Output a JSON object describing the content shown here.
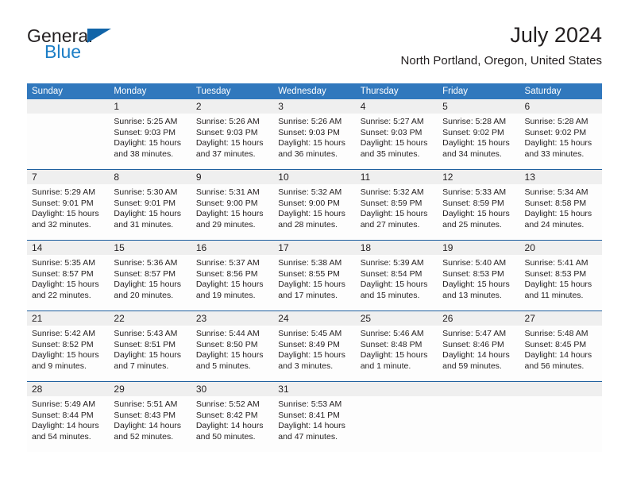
{
  "brand": {
    "name_top": "General",
    "name_bottom": "Blue",
    "accent_color": "#1164a8",
    "blue_text_color": "#1c7ec6"
  },
  "header": {
    "month_title": "July 2024",
    "location": "North Portland, Oregon, United States"
  },
  "calendar": {
    "header_bg_color": "#3178bd",
    "number_band_color": "#efefef",
    "separator_color": "#1d5e9e",
    "day_names": [
      "Sunday",
      "Monday",
      "Tuesday",
      "Wednesday",
      "Thursday",
      "Friday",
      "Saturday"
    ],
    "weeks": [
      [
        {
          "day": "",
          "sunrise": "",
          "sunset": "",
          "daylight": ""
        },
        {
          "day": "1",
          "sunrise": "Sunrise: 5:25 AM",
          "sunset": "Sunset: 9:03 PM",
          "daylight": "Daylight: 15 hours and 38 minutes."
        },
        {
          "day": "2",
          "sunrise": "Sunrise: 5:26 AM",
          "sunset": "Sunset: 9:03 PM",
          "daylight": "Daylight: 15 hours and 37 minutes."
        },
        {
          "day": "3",
          "sunrise": "Sunrise: 5:26 AM",
          "sunset": "Sunset: 9:03 PM",
          "daylight": "Daylight: 15 hours and 36 minutes."
        },
        {
          "day": "4",
          "sunrise": "Sunrise: 5:27 AM",
          "sunset": "Sunset: 9:03 PM",
          "daylight": "Daylight: 15 hours and 35 minutes."
        },
        {
          "day": "5",
          "sunrise": "Sunrise: 5:28 AM",
          "sunset": "Sunset: 9:02 PM",
          "daylight": "Daylight: 15 hours and 34 minutes."
        },
        {
          "day": "6",
          "sunrise": "Sunrise: 5:28 AM",
          "sunset": "Sunset: 9:02 PM",
          "daylight": "Daylight: 15 hours and 33 minutes."
        }
      ],
      [
        {
          "day": "7",
          "sunrise": "Sunrise: 5:29 AM",
          "sunset": "Sunset: 9:01 PM",
          "daylight": "Daylight: 15 hours and 32 minutes."
        },
        {
          "day": "8",
          "sunrise": "Sunrise: 5:30 AM",
          "sunset": "Sunset: 9:01 PM",
          "daylight": "Daylight: 15 hours and 31 minutes."
        },
        {
          "day": "9",
          "sunrise": "Sunrise: 5:31 AM",
          "sunset": "Sunset: 9:00 PM",
          "daylight": "Daylight: 15 hours and 29 minutes."
        },
        {
          "day": "10",
          "sunrise": "Sunrise: 5:32 AM",
          "sunset": "Sunset: 9:00 PM",
          "daylight": "Daylight: 15 hours and 28 minutes."
        },
        {
          "day": "11",
          "sunrise": "Sunrise: 5:32 AM",
          "sunset": "Sunset: 8:59 PM",
          "daylight": "Daylight: 15 hours and 27 minutes."
        },
        {
          "day": "12",
          "sunrise": "Sunrise: 5:33 AM",
          "sunset": "Sunset: 8:59 PM",
          "daylight": "Daylight: 15 hours and 25 minutes."
        },
        {
          "day": "13",
          "sunrise": "Sunrise: 5:34 AM",
          "sunset": "Sunset: 8:58 PM",
          "daylight": "Daylight: 15 hours and 24 minutes."
        }
      ],
      [
        {
          "day": "14",
          "sunrise": "Sunrise: 5:35 AM",
          "sunset": "Sunset: 8:57 PM",
          "daylight": "Daylight: 15 hours and 22 minutes."
        },
        {
          "day": "15",
          "sunrise": "Sunrise: 5:36 AM",
          "sunset": "Sunset: 8:57 PM",
          "daylight": "Daylight: 15 hours and 20 minutes."
        },
        {
          "day": "16",
          "sunrise": "Sunrise: 5:37 AM",
          "sunset": "Sunset: 8:56 PM",
          "daylight": "Daylight: 15 hours and 19 minutes."
        },
        {
          "day": "17",
          "sunrise": "Sunrise: 5:38 AM",
          "sunset": "Sunset: 8:55 PM",
          "daylight": "Daylight: 15 hours and 17 minutes."
        },
        {
          "day": "18",
          "sunrise": "Sunrise: 5:39 AM",
          "sunset": "Sunset: 8:54 PM",
          "daylight": "Daylight: 15 hours and 15 minutes."
        },
        {
          "day": "19",
          "sunrise": "Sunrise: 5:40 AM",
          "sunset": "Sunset: 8:53 PM",
          "daylight": "Daylight: 15 hours and 13 minutes."
        },
        {
          "day": "20",
          "sunrise": "Sunrise: 5:41 AM",
          "sunset": "Sunset: 8:53 PM",
          "daylight": "Daylight: 15 hours and 11 minutes."
        }
      ],
      [
        {
          "day": "21",
          "sunrise": "Sunrise: 5:42 AM",
          "sunset": "Sunset: 8:52 PM",
          "daylight": "Daylight: 15 hours and 9 minutes."
        },
        {
          "day": "22",
          "sunrise": "Sunrise: 5:43 AM",
          "sunset": "Sunset: 8:51 PM",
          "daylight": "Daylight: 15 hours and 7 minutes."
        },
        {
          "day": "23",
          "sunrise": "Sunrise: 5:44 AM",
          "sunset": "Sunset: 8:50 PM",
          "daylight": "Daylight: 15 hours and 5 minutes."
        },
        {
          "day": "24",
          "sunrise": "Sunrise: 5:45 AM",
          "sunset": "Sunset: 8:49 PM",
          "daylight": "Daylight: 15 hours and 3 minutes."
        },
        {
          "day": "25",
          "sunrise": "Sunrise: 5:46 AM",
          "sunset": "Sunset: 8:48 PM",
          "daylight": "Daylight: 15 hours and 1 minute."
        },
        {
          "day": "26",
          "sunrise": "Sunrise: 5:47 AM",
          "sunset": "Sunset: 8:46 PM",
          "daylight": "Daylight: 14 hours and 59 minutes."
        },
        {
          "day": "27",
          "sunrise": "Sunrise: 5:48 AM",
          "sunset": "Sunset: 8:45 PM",
          "daylight": "Daylight: 14 hours and 56 minutes."
        }
      ],
      [
        {
          "day": "28",
          "sunrise": "Sunrise: 5:49 AM",
          "sunset": "Sunset: 8:44 PM",
          "daylight": "Daylight: 14 hours and 54 minutes."
        },
        {
          "day": "29",
          "sunrise": "Sunrise: 5:51 AM",
          "sunset": "Sunset: 8:43 PM",
          "daylight": "Daylight: 14 hours and 52 minutes."
        },
        {
          "day": "30",
          "sunrise": "Sunrise: 5:52 AM",
          "sunset": "Sunset: 8:42 PM",
          "daylight": "Daylight: 14 hours and 50 minutes."
        },
        {
          "day": "31",
          "sunrise": "Sunrise: 5:53 AM",
          "sunset": "Sunset: 8:41 PM",
          "daylight": "Daylight: 14 hours and 47 minutes."
        },
        {
          "day": "",
          "sunrise": "",
          "sunset": "",
          "daylight": ""
        },
        {
          "day": "",
          "sunrise": "",
          "sunset": "",
          "daylight": ""
        },
        {
          "day": "",
          "sunrise": "",
          "sunset": "",
          "daylight": ""
        }
      ]
    ]
  }
}
